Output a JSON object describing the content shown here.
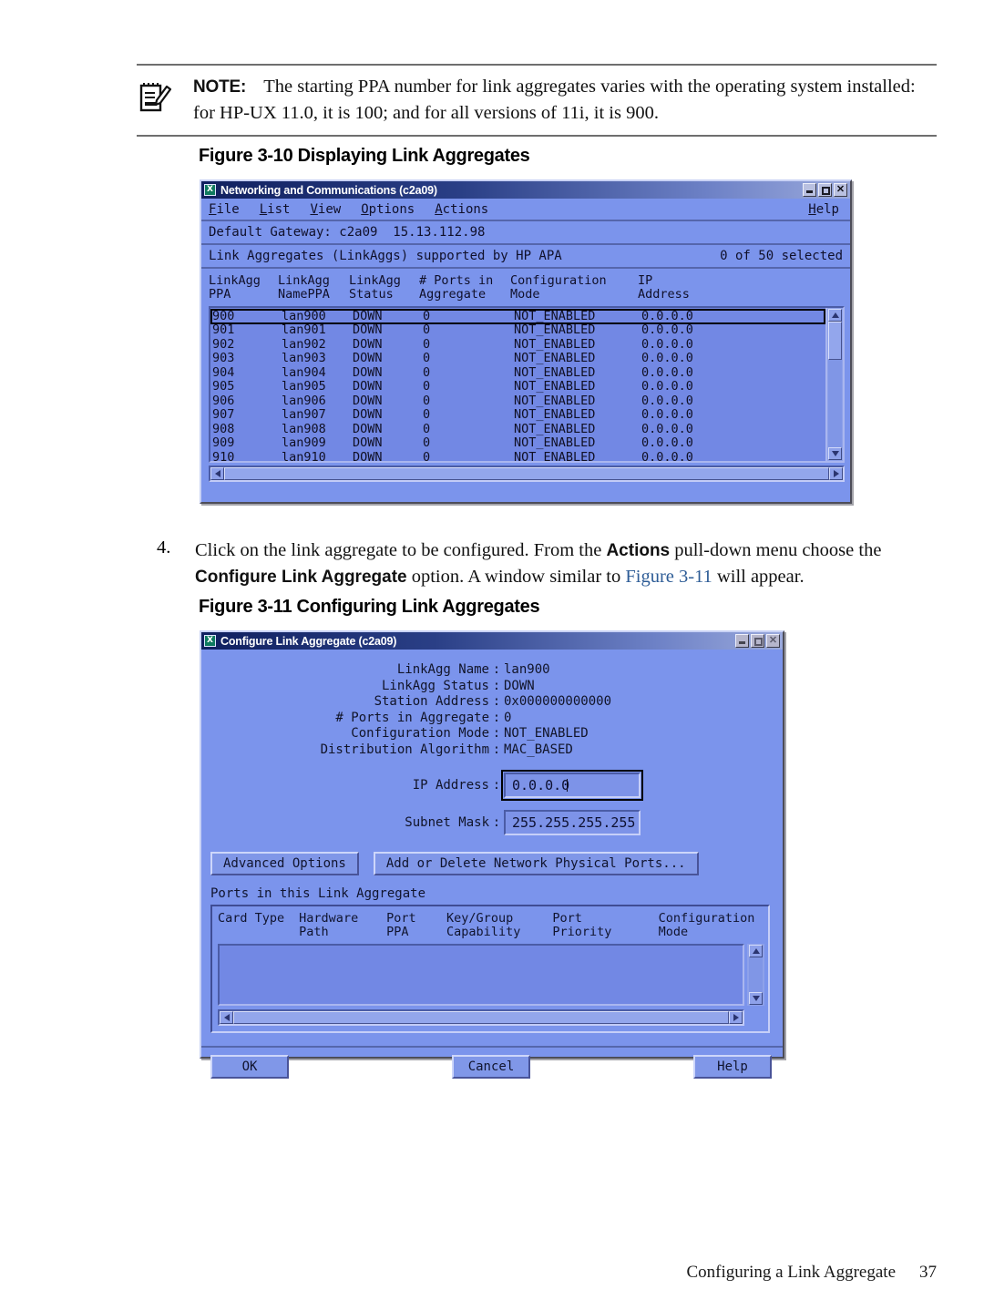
{
  "note": {
    "icon": "note-pencil-icon",
    "label": "NOTE:",
    "text": "The starting PPA number for link aggregates varies with the operating system installed: for HP-UX 11.0, it is 100; and for all versions of 11i, it is 900."
  },
  "figure_10": {
    "caption": "Figure 3-10 Displaying Link Aggregates",
    "window": {
      "title": "Networking and Communications (c2a09)",
      "icon_letter": "X",
      "controls": {
        "minimize": "minimize-button",
        "maximize": "maximize-button",
        "close": "close-button"
      },
      "menus": [
        "File",
        "List",
        "View",
        "Options",
        "Actions"
      ],
      "help_menu": "Help",
      "gateway_line": "Default Gateway: c2a09  15.13.112.98",
      "status_left": "Link Aggregates (LinkAggs) supported by HP APA",
      "status_right": "0 of 50 selected",
      "columns": [
        {
          "line1": "LinkAgg",
          "line2": "PPA"
        },
        {
          "line1": "LinkAgg",
          "line2": "NamePPA"
        },
        {
          "line1": "LinkAgg",
          "line2": "Status"
        },
        {
          "line1": "# Ports in",
          "line2": "Aggregate"
        },
        {
          "line1": "Configuration",
          "line2": "Mode"
        },
        {
          "line1": "IP",
          "line2": "Address"
        }
      ],
      "rows": [
        {
          "ppa": "900",
          "name": "lan900",
          "status": "DOWN",
          "ports": "0",
          "mode": "NOT_ENABLED",
          "ip": "0.0.0.0",
          "selected": true
        },
        {
          "ppa": "901",
          "name": "lan901",
          "status": "DOWN",
          "ports": "0",
          "mode": "NOT_ENABLED",
          "ip": "0.0.0.0",
          "selected": false
        },
        {
          "ppa": "902",
          "name": "lan902",
          "status": "DOWN",
          "ports": "0",
          "mode": "NOT_ENABLED",
          "ip": "0.0.0.0",
          "selected": false
        },
        {
          "ppa": "903",
          "name": "lan903",
          "status": "DOWN",
          "ports": "0",
          "mode": "NOT_ENABLED",
          "ip": "0.0.0.0",
          "selected": false
        },
        {
          "ppa": "904",
          "name": "lan904",
          "status": "DOWN",
          "ports": "0",
          "mode": "NOT_ENABLED",
          "ip": "0.0.0.0",
          "selected": false
        },
        {
          "ppa": "905",
          "name": "lan905",
          "status": "DOWN",
          "ports": "0",
          "mode": "NOT_ENABLED",
          "ip": "0.0.0.0",
          "selected": false
        },
        {
          "ppa": "906",
          "name": "lan906",
          "status": "DOWN",
          "ports": "0",
          "mode": "NOT_ENABLED",
          "ip": "0.0.0.0",
          "selected": false
        },
        {
          "ppa": "907",
          "name": "lan907",
          "status": "DOWN",
          "ports": "0",
          "mode": "NOT_ENABLED",
          "ip": "0.0.0.0",
          "selected": false
        },
        {
          "ppa": "908",
          "name": "lan908",
          "status": "DOWN",
          "ports": "0",
          "mode": "NOT_ENABLED",
          "ip": "0.0.0.0",
          "selected": false
        },
        {
          "ppa": "909",
          "name": "lan909",
          "status": "DOWN",
          "ports": "0",
          "mode": "NOT_ENABLED",
          "ip": "0.0.0.0",
          "selected": false
        },
        {
          "ppa": "910",
          "name": "lan910",
          "status": "DOWN",
          "ports": "0",
          "mode": "NOT_ENABLED",
          "ip": "0.0.0.0",
          "selected": false
        }
      ]
    }
  },
  "step": {
    "number": "4.",
    "part1": "Click on the link aggregate to be configured. From the ",
    "bold1": "Actions",
    "part2": " pull-down menu choose the ",
    "bold2": "Configure Link Aggregate",
    "part3": " option. A window similar to ",
    "link": "Figure 3-11",
    "part4": " will appear."
  },
  "figure_11": {
    "caption": "Figure 3-11 Configuring Link Aggregates",
    "dialog": {
      "title": "Configure Link Aggregate (c2a09)",
      "icon_letter": "X",
      "fields": [
        {
          "label": "LinkAgg Name",
          "value": "lan900"
        },
        {
          "label": "LinkAgg Status",
          "value": "DOWN"
        },
        {
          "label": "Station Address",
          "value": "0x000000000000"
        },
        {
          "label": "# Ports in Aggregate",
          "value": "0"
        },
        {
          "label": "Configuration Mode",
          "value": "NOT_ENABLED"
        },
        {
          "label": "Distribution Algorithm",
          "value": "MAC_BASED"
        }
      ],
      "inputs": [
        {
          "label": "IP Address",
          "value": "0.0.0.0",
          "focused": true
        },
        {
          "label": "Subnet Mask",
          "value": "255.255.255.255",
          "focused": false
        }
      ],
      "buttons": {
        "advanced_options": "Advanced Options",
        "add_delete_ports": "Add or Delete Network Physical Ports..."
      },
      "ports_section_label": "Ports in this Link Aggregate",
      "ports_columns": [
        {
          "line1": "Card Type",
          "line2": ""
        },
        {
          "line1": "Hardware",
          "line2": "Path"
        },
        {
          "line1": "Port",
          "line2": "PPA"
        },
        {
          "line1": "Key/Group",
          "line2": "Capability"
        },
        {
          "line1": "Port",
          "line2": "Priority"
        },
        {
          "line1": "Configuration",
          "line2": "Mode"
        }
      ],
      "ports_rows": [],
      "footer_buttons": {
        "ok": "OK",
        "cancel": "Cancel",
        "help": "Help"
      }
    }
  },
  "page_footer": {
    "title": "Configuring a Link Aggregate",
    "number": "37"
  },
  "colors": {
    "motif_face": "#7b94ec",
    "titlebar_dark": "#10205f",
    "list_bg": "#7288e4",
    "text_dark": "#10102a",
    "link": "#2d5c96"
  }
}
